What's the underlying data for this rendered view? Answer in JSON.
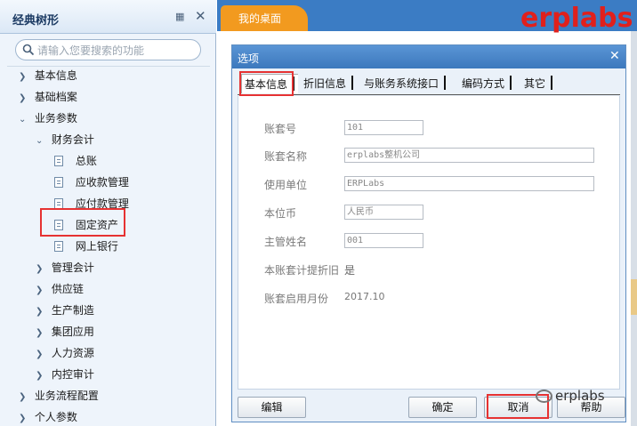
{
  "sidebar": {
    "title": "经典树形",
    "search_placeholder": "请输入您要搜索的功能",
    "tree": [
      {
        "label": "基本信息"
      },
      {
        "label": "基础档案"
      },
      {
        "label": "业务参数"
      },
      {
        "label": "财务会计"
      },
      {
        "label": "总账"
      },
      {
        "label": "应收款管理"
      },
      {
        "label": "应付款管理"
      },
      {
        "label": "固定资产"
      },
      {
        "label": "网上银行"
      },
      {
        "label": "管理会计"
      },
      {
        "label": "供应链"
      },
      {
        "label": "生产制造"
      },
      {
        "label": "集团应用"
      },
      {
        "label": "人力资源"
      },
      {
        "label": "内控审计"
      },
      {
        "label": "业务流程配置"
      },
      {
        "label": "个人参数"
      }
    ]
  },
  "topbar": {
    "tab_label": "我的桌面",
    "brand": "erplabs"
  },
  "dialog": {
    "title": "选项",
    "tabs": [
      {
        "label": "基本信息"
      },
      {
        "label": "折旧信息"
      },
      {
        "label": "与账务系统接口"
      },
      {
        "label": "编码方式"
      },
      {
        "label": "其它"
      }
    ],
    "fields": [
      {
        "label": "账套号",
        "value": "101"
      },
      {
        "label": "账套名称",
        "value": "erplabs整机公司"
      },
      {
        "label": "使用单位",
        "value": "ERPLabs"
      },
      {
        "label": "本位币",
        "value": "人民币"
      },
      {
        "label": "主管姓名",
        "value": "001"
      },
      {
        "label": "本账套计提折旧",
        "value": "是"
      },
      {
        "label": "账套启用月份",
        "value": "2017.10"
      }
    ],
    "buttons": {
      "edit": "编辑",
      "ok": "确定",
      "cancel": "取消",
      "help": "帮助"
    }
  },
  "watermark": "erplabs",
  "colors": {
    "accent_blue": "#3b7cc4",
    "tab_orange": "#f29a1f",
    "highlight_red": "#e63232",
    "brand_red": "#e0201c"
  }
}
